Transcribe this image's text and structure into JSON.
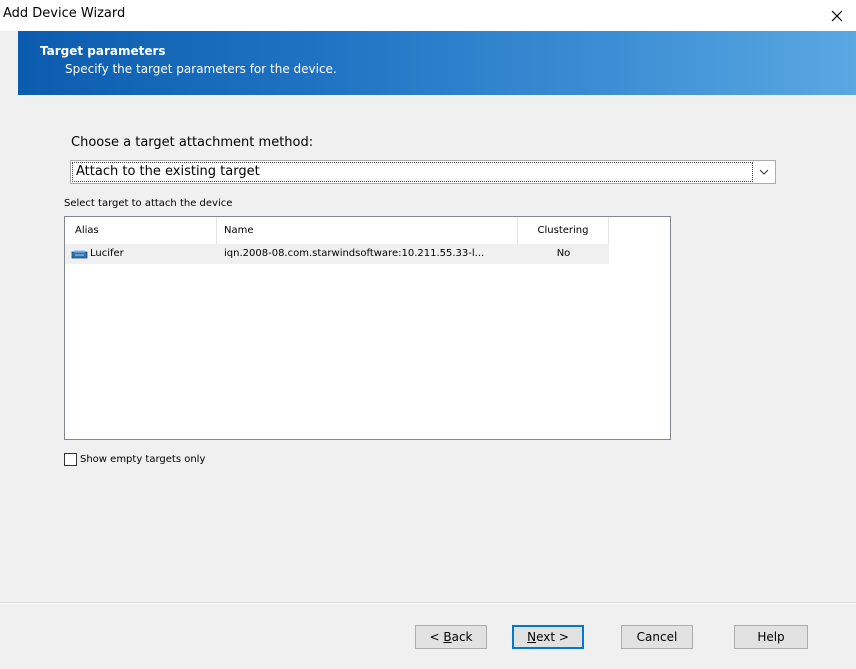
{
  "window": {
    "title": "Add Device Wizard"
  },
  "banner": {
    "title": "Target parameters",
    "subtitle": "Specify the target parameters for the device."
  },
  "colors": {
    "banner_start": "#0b5cae",
    "banner_end": "#5aa8e2",
    "default_button_border": "#0078d7"
  },
  "method": {
    "label": "Choose a target attachment method:",
    "selected": "Attach to the existing target"
  },
  "targets": {
    "label": "Select target to attach the device",
    "columns": {
      "alias": "Alias",
      "name": "Name",
      "clustering": "Clustering"
    },
    "rows": [
      {
        "icon": "target-device-icon",
        "alias": "Lucifer",
        "name": "iqn.2008-08.com.starwindsoftware:10.211.55.33-l...",
        "clustering": "No"
      }
    ]
  },
  "show_empty_only": {
    "label": "Show empty targets only",
    "checked": false
  },
  "buttons": {
    "back": {
      "prefix": "< ",
      "accel": "B",
      "rest": "ack"
    },
    "next": {
      "accel": "N",
      "rest": "ext >"
    },
    "cancel": "Cancel",
    "help": "Help"
  }
}
